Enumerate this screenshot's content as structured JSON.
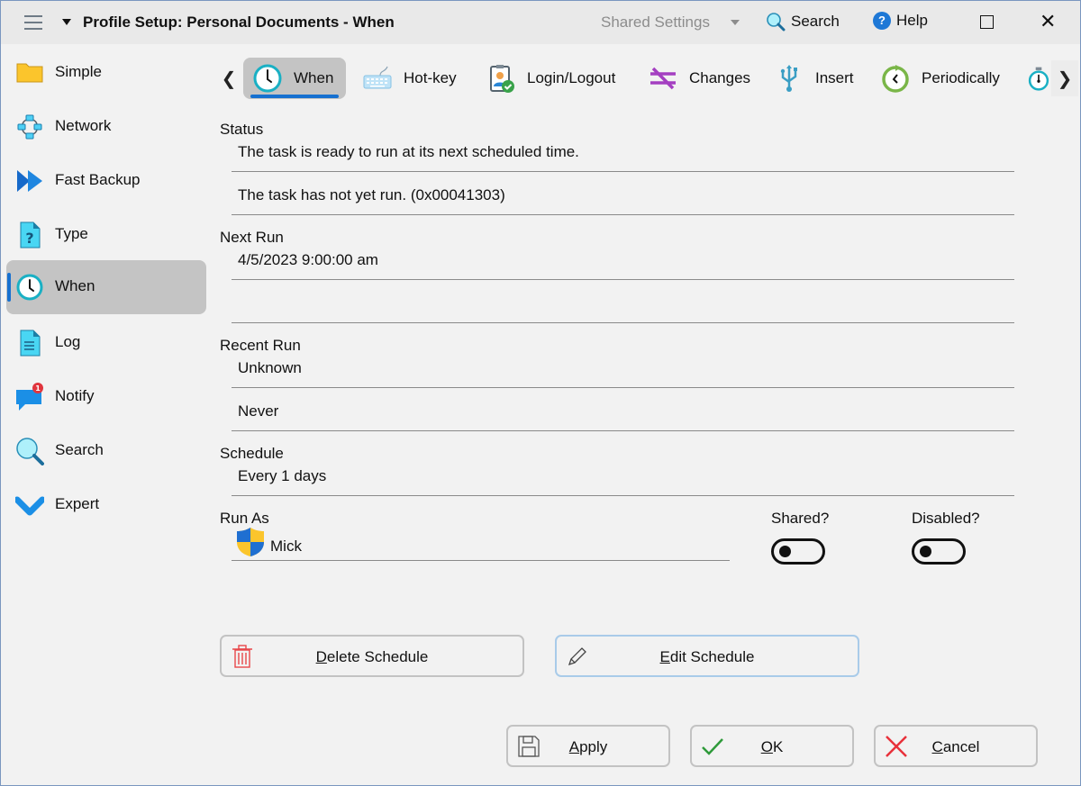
{
  "titlebar": {
    "title": "Profile Setup: Personal Documents - When",
    "shared_settings": "Shared Settings",
    "search": "Search",
    "help": "Help",
    "help_glyph": "?"
  },
  "sidebar": {
    "items": [
      {
        "label": "Simple",
        "icon": "folder-icon"
      },
      {
        "label": "Network",
        "icon": "network-icon"
      },
      {
        "label": "Fast Backup",
        "icon": "fast-forward-icon"
      },
      {
        "label": "Type",
        "icon": "question-document-icon"
      },
      {
        "label": "When",
        "icon": "clock-icon",
        "active": true
      },
      {
        "label": "Log",
        "icon": "document-icon"
      },
      {
        "label": "Notify",
        "icon": "chat-bubble-icon",
        "badge": "1"
      },
      {
        "label": "Search",
        "icon": "magnifier-icon"
      },
      {
        "label": "Expert",
        "icon": "checkmark-chevron-icon"
      }
    ]
  },
  "tabs": [
    {
      "label": "When",
      "icon": "clock-icon",
      "active": true
    },
    {
      "label": "Hot-key",
      "icon": "keyboard-icon"
    },
    {
      "label": "Login/Logout",
      "icon": "login-badge-icon"
    },
    {
      "label": "Changes",
      "icon": "not-equal-icon"
    },
    {
      "label": "Insert",
      "icon": "usb-icon"
    },
    {
      "label": "Periodically",
      "icon": "refresh-clock-icon"
    },
    {
      "label": "",
      "icon": "stopwatch-icon"
    }
  ],
  "status": {
    "label": "Status",
    "line1": "The task is ready to run at its next scheduled time.",
    "line2": "The task has not yet run. (0x00041303)"
  },
  "next_run": {
    "label": "Next Run",
    "line1": "4/5/2023 9:00:00 am",
    "line2": ""
  },
  "recent_run": {
    "label": "Recent Run",
    "line1": "Unknown",
    "line2": "Never"
  },
  "schedule": {
    "label": "Schedule",
    "value": "Every 1 days"
  },
  "run_as": {
    "label": "Run As",
    "user": "Mick"
  },
  "toggles": {
    "shared": {
      "label": "Shared?",
      "on": false
    },
    "disabled": {
      "label": "Disabled?",
      "on": false
    }
  },
  "buttons": {
    "delete_schedule": {
      "mnemonic": "D",
      "rest": "elete Schedule"
    },
    "edit_schedule": {
      "mnemonic": "E",
      "rest": "dit Schedule"
    },
    "apply": {
      "mnemonic": "A",
      "rest": "pply"
    },
    "ok": {
      "mnemonic": "O",
      "rest": "K"
    },
    "cancel": {
      "mnemonic": "C",
      "rest": "ancel"
    }
  },
  "colors": {
    "accent": "#1670d0",
    "selected_bg": "#c4c4c4",
    "delete_red": "#e8474a",
    "ok_green": "#2e9a3a",
    "cancel_red": "#e8313a"
  }
}
